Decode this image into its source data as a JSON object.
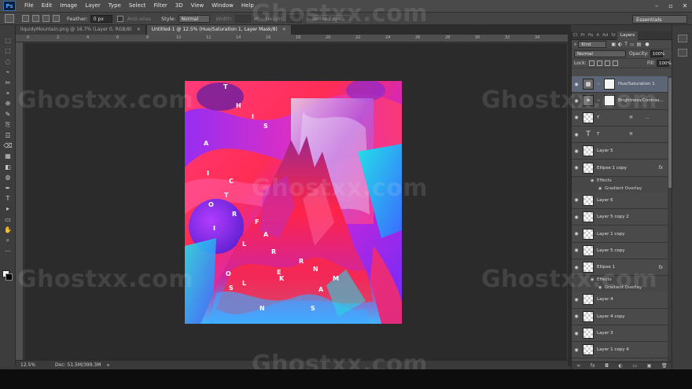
{
  "menu": [
    "File",
    "Edit",
    "Image",
    "Layer",
    "Type",
    "Select",
    "Filter",
    "3D",
    "View",
    "Window",
    "Help"
  ],
  "app_logo": "Ps",
  "options": {
    "feather_label": "Feather:",
    "feather_value": "0 px",
    "antialias_label": "Anti-alias",
    "style_label": "Style:",
    "style_value": "Normal",
    "width_label": "Width:",
    "height_label": "Height:",
    "refine_edge": "Refine Edge..."
  },
  "workspace": "Essentials",
  "tabs": [
    {
      "label": "liquidyMountain.png @ 16.7% (Layer 0, RGB/8)",
      "close": "×"
    },
    {
      "label": "Untitled-1 @ 12.5% (Hue/Saturation 1, Layer Mask/8)",
      "close": "×"
    }
  ],
  "ruler_numbers": [
    "0",
    "2",
    "4",
    "6",
    "8",
    "10",
    "12",
    "14",
    "16",
    "18",
    "20",
    "22",
    "24",
    "26",
    "28",
    "30",
    "32",
    "34"
  ],
  "status": {
    "zoom": "12.5%",
    "doc": "Doc: 51.5M/399.3M",
    "arrow": "▸"
  },
  "panel": {
    "tabs_inactive": [
      "Cl",
      "Pr",
      "Pa",
      "A",
      "Ad",
      "St"
    ],
    "active_tab": "Layers",
    "kind_label": "Kind",
    "blend_mode": "Normal",
    "opacity_label": "Opacity:",
    "opacity_value": "100%",
    "lock_label": "Lock:",
    "fill_label": "Fill:",
    "fill_value": "100%"
  },
  "layers": [
    {
      "name": "Hue/Saturation 1",
      "kind": "adj",
      "adj_icon": "▦",
      "selected": true,
      "mask": true
    },
    {
      "name": "Brightness/Contras...",
      "kind": "adj",
      "adj_icon": "☀",
      "mask": true
    },
    {
      "name": "T",
      "kind": "pixel",
      "extra": "H",
      "dots": "..."
    },
    {
      "name": "T",
      "kind": "text",
      "extra": "H"
    },
    {
      "name": "Layer 5",
      "kind": "pixel"
    },
    {
      "name": "Ellipse 1 copy",
      "kind": "pixel",
      "fx": "fx",
      "effects": [
        "Effects",
        "Gradient Overlay"
      ]
    },
    {
      "name": "Layer 6",
      "kind": "pixel"
    },
    {
      "name": "Layer 5 copy 2",
      "kind": "pixel"
    },
    {
      "name": "Layer 1 copy",
      "kind": "pixel"
    },
    {
      "name": "Layer 5 copy",
      "kind": "pixel"
    },
    {
      "name": "Ellipse 1",
      "kind": "pixel",
      "fx": "fx",
      "effects": [
        "Effects",
        "Gradient Overlay"
      ]
    },
    {
      "name": "Layer 4",
      "kind": "pixel"
    },
    {
      "name": "Layer 4 copy",
      "kind": "pixel"
    },
    {
      "name": "Layer 3",
      "kind": "pixel"
    },
    {
      "name": "Layer 1 copy 4",
      "kind": "pixel"
    }
  ],
  "footer_icons": [
    "∞",
    "fx",
    "◘",
    "◐",
    "▭",
    "▣",
    "🗑"
  ],
  "artwork_letters": [
    "T",
    "H",
    "I",
    "S",
    "A",
    "I",
    "C",
    "T",
    "O",
    "R",
    "I",
    "L",
    "F",
    "A",
    "R",
    "O",
    "S",
    "L",
    "E",
    "K",
    "R",
    "N",
    "M",
    "A",
    "N",
    "S"
  ],
  "watermark": "Ghostxx.com",
  "colors": {
    "accent_selected": "#5d6677",
    "bg": "#3a3a3a",
    "canvas": "#2b2b2b"
  }
}
